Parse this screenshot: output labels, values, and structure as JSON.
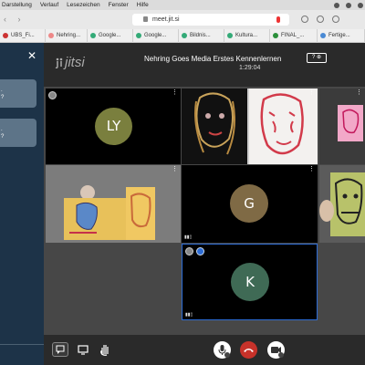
{
  "menubar": {
    "items": [
      "Darstellung",
      "Verlauf",
      "Lesezeichen",
      "Fenster",
      "Hilfe"
    ]
  },
  "browser": {
    "url": "meet.jit.si",
    "nav_arrows": "‹ ›"
  },
  "bookmarks": [
    {
      "label": "UBS_Fi...",
      "color": "#c33"
    },
    {
      "label": "Nehring...",
      "color": "#e88"
    },
    {
      "label": "Google...",
      "color": "#3a7"
    },
    {
      "label": "Google...",
      "color": "#3a7"
    },
    {
      "label": "Bildnis...",
      "color": "#3a7"
    },
    {
      "label": "Kultura...",
      "color": "#3a7"
    },
    {
      "label": "FINAL_...",
      "color": "#2a8f3a"
    },
    {
      "label": "Fertige...",
      "color": "#4a8ad4"
    }
  ],
  "sidebar": {
    "close_icon": "close-icon",
    "messages": [
      {
        "lines": [
          ".",
          "?"
        ]
      },
      {
        "lines": [
          ".",
          "?"
        ]
      }
    ]
  },
  "meeting": {
    "logo": "jitsi",
    "title": "Nehring Goes Media Erstes Kennenlernen",
    "timer": "1:29:04",
    "quality_badge": "? ⊕"
  },
  "tiles": {
    "ly": {
      "initials": "LY",
      "color": "#7a7f3e"
    },
    "g": {
      "initials": "G",
      "color": "#7f6a45"
    },
    "k": {
      "initials": "K",
      "color": "#3f6a55"
    },
    "more": "⋮"
  },
  "toolbar": {
    "chat_icon": "chat-icon",
    "screenshare_icon": "screen-share-icon",
    "raisehand_icon": "raise-hand-icon",
    "mic_icon": "microphone-icon",
    "hangup_icon": "hangup-icon",
    "camera_icon": "camera-icon",
    "hangup_color": "#c7322a"
  }
}
